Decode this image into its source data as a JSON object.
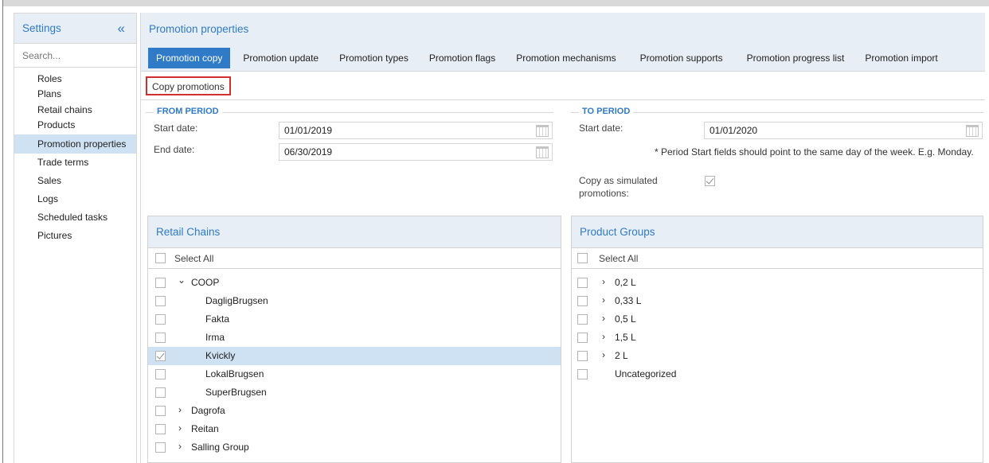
{
  "sidebar": {
    "title": "Settings",
    "search_placeholder": "Search...",
    "items": [
      {
        "label": "Roles"
      },
      {
        "label": "Plans"
      },
      {
        "label": "Retail chains"
      },
      {
        "label": "Products"
      },
      {
        "label": "Promotion properties",
        "active": true
      },
      {
        "label": "Trade terms"
      },
      {
        "label": "Sales"
      },
      {
        "label": "Logs"
      },
      {
        "label": "Scheduled tasks"
      },
      {
        "label": "Pictures"
      }
    ]
  },
  "main": {
    "title": "Promotion properties",
    "tabs": [
      {
        "label": "Promotion copy",
        "active": true
      },
      {
        "label": "Promotion update"
      },
      {
        "label": "Promotion types"
      },
      {
        "label": "Promotion flags"
      },
      {
        "label": "Promotion mechanisms"
      },
      {
        "label": "Promotion supports"
      },
      {
        "label": "Promotion progress list"
      },
      {
        "label": "Promotion import"
      }
    ],
    "subtab": "Copy promotions"
  },
  "from_period": {
    "legend": "FROM PERIOD",
    "start_label": "Start date:",
    "start_value": "01/01/2019",
    "end_label": "End date:",
    "end_value": "06/30/2019"
  },
  "to_period": {
    "legend": "TO PERIOD",
    "start_label": "Start date:",
    "start_value": "01/01/2020",
    "note": "* Period Start fields should point to the same day of the week. E.g. Monday.",
    "simulated_label_1": "Copy as simulated",
    "simulated_label_2": "promotions:",
    "simulated_checked": true
  },
  "retail_chains": {
    "title": "Retail Chains",
    "select_all": "Select All",
    "rows": [
      {
        "label": "COOP",
        "level": 0,
        "expander": "expanded",
        "checked": false
      },
      {
        "label": "DagligBrugsen",
        "level": 1,
        "checked": false
      },
      {
        "label": "Fakta",
        "level": 1,
        "checked": false
      },
      {
        "label": "Irma",
        "level": 1,
        "checked": false
      },
      {
        "label": "Kvickly",
        "level": 1,
        "checked": true,
        "selected": true
      },
      {
        "label": "LokalBrugsen",
        "level": 1,
        "checked": false
      },
      {
        "label": "SuperBrugsen",
        "level": 1,
        "checked": false
      },
      {
        "label": "Dagrofa",
        "level": 0,
        "expander": "collapsed",
        "checked": false
      },
      {
        "label": "Reitan",
        "level": 0,
        "expander": "collapsed",
        "checked": false
      },
      {
        "label": "Salling Group",
        "level": 0,
        "expander": "collapsed",
        "checked": false
      }
    ]
  },
  "product_groups": {
    "title": "Product Groups",
    "select_all": "Select All",
    "rows": [
      {
        "label": "0,2 L",
        "expander": "collapsed",
        "checked": false
      },
      {
        "label": "0,33 L",
        "expander": "collapsed",
        "checked": false
      },
      {
        "label": "0,5 L",
        "expander": "collapsed",
        "checked": false
      },
      {
        "label": "1,5 L",
        "expander": "collapsed",
        "checked": false
      },
      {
        "label": "2 L",
        "expander": "collapsed",
        "checked": false
      },
      {
        "label": "Uncategorized",
        "expander": "none",
        "checked": false
      }
    ]
  },
  "icons": {
    "collapse": "double-chevron-left-icon",
    "expanded": "chevron-down-icon",
    "collapsed": "chevron-right-icon",
    "calendar": "calendar-icon"
  },
  "colors": {
    "accent": "#2f7bc7",
    "header_bg": "#e8eef5",
    "selected_bg": "#cfe2f3",
    "highlight_border": "#d32f2f"
  }
}
